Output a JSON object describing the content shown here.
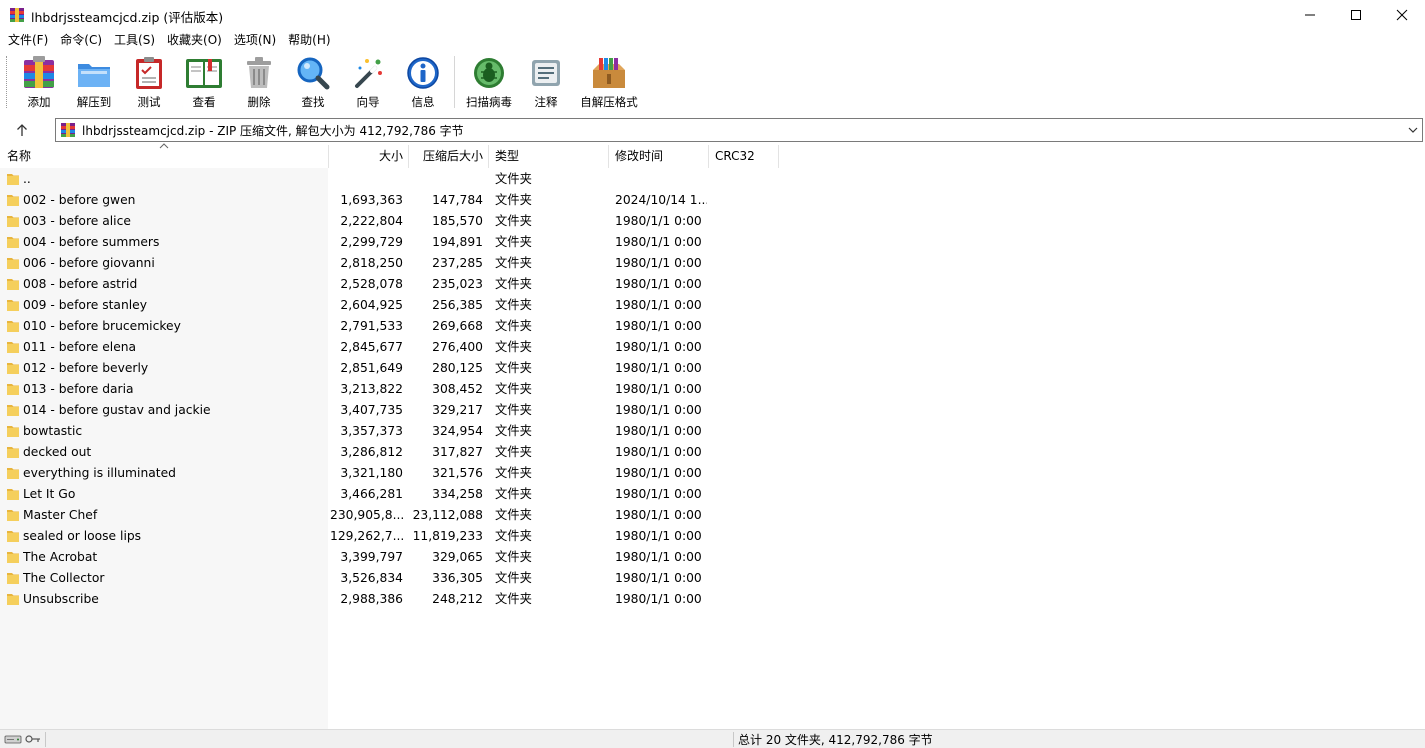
{
  "window": {
    "title": "lhbdrjssteamcjcd.zip (评估版本)"
  },
  "menu": [
    "文件(F)",
    "命令(C)",
    "工具(S)",
    "收藏夹(O)",
    "选项(N)",
    "帮助(H)"
  ],
  "toolbar": {
    "add": "添加",
    "extract": "解压到",
    "test": "测试",
    "view": "查看",
    "delete": "删除",
    "find": "查找",
    "wizard": "向导",
    "info": "信息",
    "scan": "扫描病毒",
    "comment": "注释",
    "sfx": "自解压格式"
  },
  "address": {
    "text": "lhbdrjssteamcjcd.zip - ZIP 压缩文件, 解包大小为 412,792,786 字节"
  },
  "columns": {
    "name": "名称",
    "size": "大小",
    "packed": "压缩后大小",
    "type": "类型",
    "modified": "修改时间",
    "crc": "CRC32"
  },
  "rows": [
    {
      "name": "..",
      "size": "",
      "packed": "",
      "type": "文件夹",
      "modified": ""
    },
    {
      "name": "002 - before gwen",
      "size": "1,693,363",
      "packed": "147,784",
      "type": "文件夹",
      "modified": "2024/10/14 1..."
    },
    {
      "name": "003 - before alice",
      "size": "2,222,804",
      "packed": "185,570",
      "type": "文件夹",
      "modified": "1980/1/1 0:00"
    },
    {
      "name": "004 - before summers",
      "size": "2,299,729",
      "packed": "194,891",
      "type": "文件夹",
      "modified": "1980/1/1 0:00"
    },
    {
      "name": "006 - before giovanni",
      "size": "2,818,250",
      "packed": "237,285",
      "type": "文件夹",
      "modified": "1980/1/1 0:00"
    },
    {
      "name": "008 - before astrid",
      "size": "2,528,078",
      "packed": "235,023",
      "type": "文件夹",
      "modified": "1980/1/1 0:00"
    },
    {
      "name": "009 - before stanley",
      "size": "2,604,925",
      "packed": "256,385",
      "type": "文件夹",
      "modified": "1980/1/1 0:00"
    },
    {
      "name": "010 - before brucemickey",
      "size": "2,791,533",
      "packed": "269,668",
      "type": "文件夹",
      "modified": "1980/1/1 0:00"
    },
    {
      "name": "011 - before elena",
      "size": "2,845,677",
      "packed": "276,400",
      "type": "文件夹",
      "modified": "1980/1/1 0:00"
    },
    {
      "name": "012 - before beverly",
      "size": "2,851,649",
      "packed": "280,125",
      "type": "文件夹",
      "modified": "1980/1/1 0:00"
    },
    {
      "name": "013 - before daria",
      "size": "3,213,822",
      "packed": "308,452",
      "type": "文件夹",
      "modified": "1980/1/1 0:00"
    },
    {
      "name": "014 - before gustav and jackie",
      "size": "3,407,735",
      "packed": "329,217",
      "type": "文件夹",
      "modified": "1980/1/1 0:00"
    },
    {
      "name": "bowtastic",
      "size": "3,357,373",
      "packed": "324,954",
      "type": "文件夹",
      "modified": "1980/1/1 0:00"
    },
    {
      "name": "decked out",
      "size": "3,286,812",
      "packed": "317,827",
      "type": "文件夹",
      "modified": "1980/1/1 0:00"
    },
    {
      "name": "everything is illuminated",
      "size": "3,321,180",
      "packed": "321,576",
      "type": "文件夹",
      "modified": "1980/1/1 0:00"
    },
    {
      "name": "Let It Go",
      "size": "3,466,281",
      "packed": "334,258",
      "type": "文件夹",
      "modified": "1980/1/1 0:00"
    },
    {
      "name": "Master Chef",
      "size": "230,905,8...",
      "packed": "23,112,088",
      "type": "文件夹",
      "modified": "1980/1/1 0:00"
    },
    {
      "name": "sealed or loose lips",
      "size": "129,262,7...",
      "packed": "11,819,233",
      "type": "文件夹",
      "modified": "1980/1/1 0:00"
    },
    {
      "name": "The Acrobat",
      "size": "3,399,797",
      "packed": "329,065",
      "type": "文件夹",
      "modified": "1980/1/1 0:00"
    },
    {
      "name": "The Collector",
      "size": "3,526,834",
      "packed": "336,305",
      "type": "文件夹",
      "modified": "1980/1/1 0:00"
    },
    {
      "name": "Unsubscribe",
      "size": "2,988,386",
      "packed": "248,212",
      "type": "文件夹",
      "modified": "1980/1/1 0:00"
    }
  ],
  "status": {
    "summary": "总计 20 文件夹, 412,792,786 字节"
  },
  "colors": {
    "folder": "#f5cf5c",
    "accent": "#1f6fc5"
  }
}
